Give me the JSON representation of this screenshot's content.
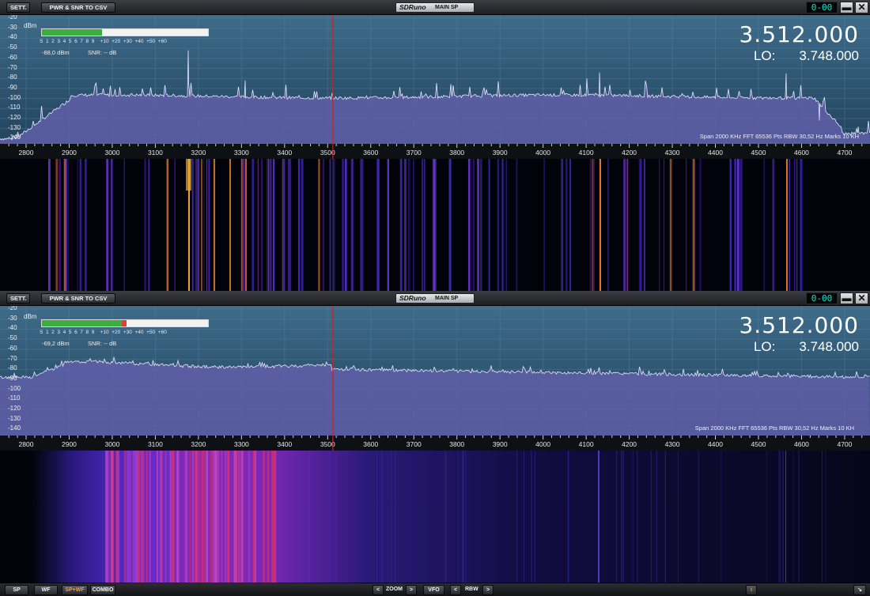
{
  "panels": [
    {
      "id": "top",
      "toolbar": {
        "sett_label": "SETT.",
        "csv_label": "PWR & SNR TO CSV",
        "logo": "SDRuno",
        "mode": "MAIN SP",
        "display": "0-00"
      },
      "dbm_unit": "dBm",
      "y_ticks": [
        "-20",
        "-30",
        "-40",
        "-50",
        "-60",
        "-70",
        "-80",
        "-90",
        "-100",
        "-110",
        "-120",
        "-130",
        "-140"
      ],
      "smeter": {
        "scale": "S  1  2  3  4  5  6  7  8  9    +10  +20  +30  +40  +50  +60",
        "level": 0.36,
        "over": 0
      },
      "dbm_readout": "-88,0 dBm",
      "snr_readout": "SNR: -- dB",
      "frequency": "3.512.000",
      "lo_label": "LO:",
      "lo_value": "3.748.000",
      "info": "Span 2000 KHz   FFT 65536 Pts   RBW 30,52 Hz   Marks 10 KH",
      "cursor_khz": 3512
    },
    {
      "id": "bottom",
      "toolbar": {
        "sett_label": "SETT.",
        "csv_label": "PWR & SNR TO CSV",
        "logo": "SDRuno",
        "mode": "MAIN SP",
        "display": "0-00"
      },
      "dbm_unit": "dBm",
      "y_ticks": [
        "-20",
        "-30",
        "-40",
        "-50",
        "-60",
        "-70",
        "-80",
        "-90",
        "-100",
        "-110",
        "-120",
        "-130",
        "-140"
      ],
      "smeter": {
        "scale": "S  1  2  3  4  5  6  7  8  9    +10  +20  +30  +40  +50  +60",
        "level": 0.48,
        "over": 0.03
      },
      "dbm_readout": "-69,2 dBm",
      "snr_readout": "SNR: -- dB",
      "frequency": "3.512.000",
      "lo_label": "LO:",
      "lo_value": "3.748.000",
      "info": "Span 2000 KHz   FFT 65536 Pts   RBW 30,52 Hz   Marks 10 KH",
      "cursor_khz": 3512
    }
  ],
  "x_ticks": [
    "2800",
    "2900",
    "3000",
    "3100",
    "3200",
    "3300",
    "3400",
    "3500",
    "3600",
    "3700",
    "3800",
    "3900",
    "4000",
    "4100",
    "4200",
    "4300",
    "4400",
    "4500",
    "4600",
    "4700"
  ],
  "window_buttons": {
    "minimize": "▬",
    "close": "✕"
  },
  "statusbar": {
    "sp": "SP",
    "wf": "WF",
    "spwf": "SP+WF",
    "combo": "COMBO",
    "zoom_prev": "<",
    "zoom": "ZOOM",
    "zoom_next": ">",
    "vfo": "VFO",
    "rbw_prev": "<",
    "rbw": "RBW",
    "rbw_next": ">",
    "info": "i"
  },
  "colors": {
    "spectrum_fill": "#5f5fa8",
    "trace": "#e6e6ff",
    "cursor": "#c0262a",
    "waterfall_bg": "#02020a"
  }
}
